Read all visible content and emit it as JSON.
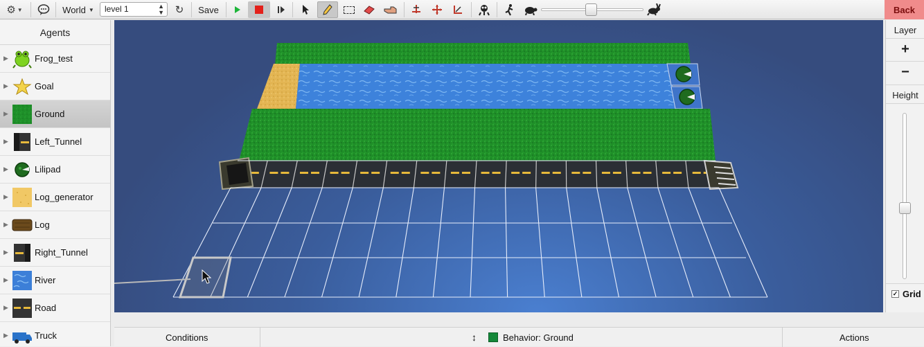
{
  "toolbar": {
    "world_label": "World",
    "level_select": "level 1",
    "save_label": "Save",
    "back_label": "Back",
    "speed_fraction": 0.5
  },
  "agents": {
    "header": "Agents",
    "items": [
      {
        "label": "Frog_test"
      },
      {
        "label": "Goal"
      },
      {
        "label": "Ground"
      },
      {
        "label": "Left_Tunnel"
      },
      {
        "label": "Lilipad"
      },
      {
        "label": "Log_generator"
      },
      {
        "label": "Log"
      },
      {
        "label": "Right_Tunnel"
      },
      {
        "label": "River"
      },
      {
        "label": "Road"
      },
      {
        "label": "Truck"
      }
    ],
    "selected": "Ground"
  },
  "right_panel": {
    "layer_label": "Layer",
    "height_label": "Height",
    "grid_label": "Grid",
    "grid_checked": true
  },
  "bottom": {
    "conditions_label": "Conditions",
    "behavior_label": "Behavior: Ground",
    "actions_label": "Actions"
  },
  "colors": {
    "back_button": "#f08b8b",
    "ground_green": "#1d8f2a",
    "river_blue": "#3c7fd8",
    "sand": "#e0b24a",
    "selected_swatch": "#15883a"
  }
}
